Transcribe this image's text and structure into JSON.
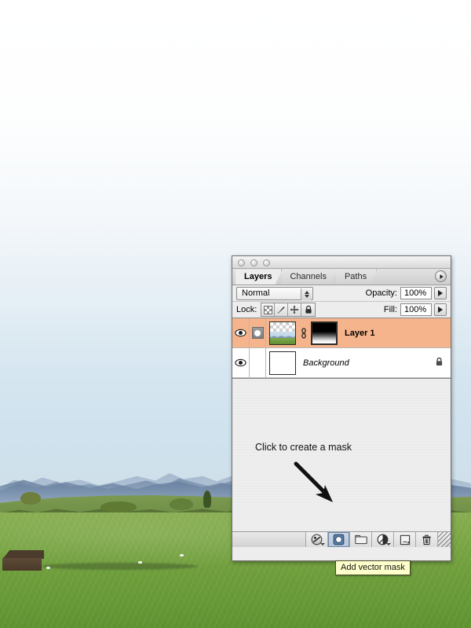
{
  "background": {
    "description": "alpine meadow photograph with mountains on the horizon",
    "sky_color": "#ffffff",
    "meadow_color": "#79a544",
    "mountain_color": "#6e86a4"
  },
  "palette": {
    "window_controls": [
      "close",
      "minimize",
      "zoom"
    ],
    "tabs": [
      {
        "label": "Layers",
        "active": true
      },
      {
        "label": "Channels",
        "active": false
      },
      {
        "label": "Paths",
        "active": false
      }
    ],
    "menu_button_icon": "palette-menu-arrow-icon",
    "blend": {
      "mode": "Normal",
      "opacity_label": "Opacity:",
      "opacity_value": "100%"
    },
    "lock": {
      "label": "Lock:",
      "buttons": [
        {
          "name": "lock-transparent-pixels",
          "icon": "checkerboard-icon"
        },
        {
          "name": "lock-image-pixels",
          "icon": "brush-icon"
        },
        {
          "name": "lock-position",
          "icon": "move-cross-icon"
        },
        {
          "name": "lock-all",
          "icon": "padlock-icon"
        }
      ],
      "fill_label": "Fill:",
      "fill_value": "100%"
    },
    "layers": [
      {
        "name": "Layer 1",
        "visible": true,
        "selected": true,
        "has_mask": true,
        "italic": false,
        "locked": false,
        "thumb": "landscape-with-transparency",
        "mask_thumb": "black-to-white-gradient"
      },
      {
        "name": "Background",
        "visible": true,
        "selected": false,
        "has_mask": false,
        "italic": true,
        "locked": true,
        "thumb": "white",
        "mask_thumb": ""
      }
    ],
    "annotation": {
      "text": "Click to create a mask",
      "arrow_icon": "down-right-arrow-icon"
    },
    "bottom_toolbar": [
      {
        "name": "add-layer-style-button",
        "icon": "fx-circle-icon",
        "has_caret": true,
        "pressed": false
      },
      {
        "name": "add-layer-mask-button",
        "icon": "mask-rounded-square-icon",
        "has_caret": false,
        "pressed": true
      },
      {
        "name": "create-new-group-button",
        "icon": "folder-icon",
        "has_caret": false,
        "pressed": false
      },
      {
        "name": "create-adjustment-layer-button",
        "icon": "half-filled-circle-icon",
        "has_caret": true,
        "pressed": false
      },
      {
        "name": "create-new-layer-button",
        "icon": "new-page-icon",
        "has_caret": false,
        "pressed": false
      },
      {
        "name": "delete-layer-button",
        "icon": "trash-icon",
        "has_caret": false,
        "pressed": false
      }
    ],
    "resize_grip_icon": "resize-grip-icon"
  },
  "tooltip": {
    "text": "Add vector mask",
    "background": "#ffffcc",
    "border": "#4a4a2a"
  }
}
